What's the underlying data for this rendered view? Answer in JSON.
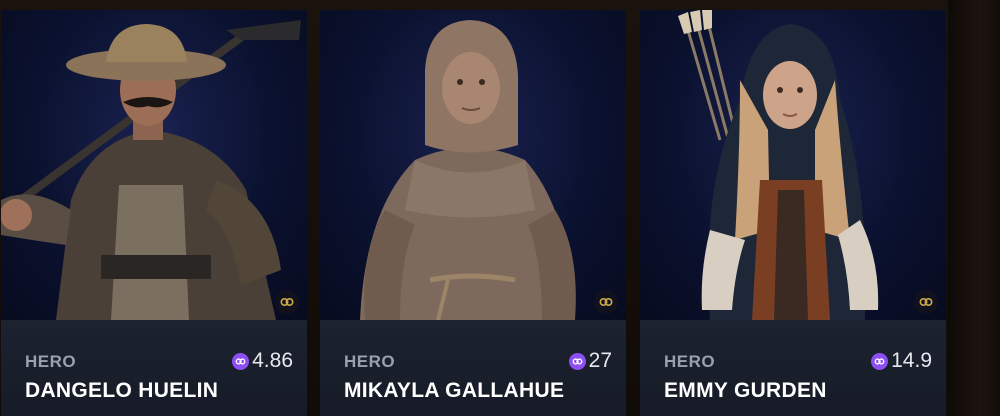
{
  "cards": [
    {
      "role": "HERO",
      "price": "4.86",
      "name": "DANGELO HUELIN",
      "portrait_icon": "farmer-with-straw-hat-portrait",
      "currency_icon": "polygon-matic-icon",
      "chain_icon": "polygon-chain-icon"
    },
    {
      "role": "HERO",
      "price": "27",
      "name": "MIKAYLA GALLAHUE",
      "portrait_icon": "hooded-woman-portrait",
      "currency_icon": "polygon-matic-icon",
      "chain_icon": "polygon-chain-icon"
    },
    {
      "role": "HERO",
      "price": "14.9",
      "name": "EMMY GURDEN",
      "portrait_icon": "hooded-archer-portrait",
      "currency_icon": "polygon-matic-icon",
      "chain_icon": "polygon-chain-icon"
    }
  ],
  "colors": {
    "card_art_bg": "#0c1330",
    "info_bg": "#1c2230",
    "role_text": "#9aa0ad",
    "name_text": "#ffffff",
    "coin": "#8d4ff4",
    "chain_badge": "#c9a94a"
  }
}
